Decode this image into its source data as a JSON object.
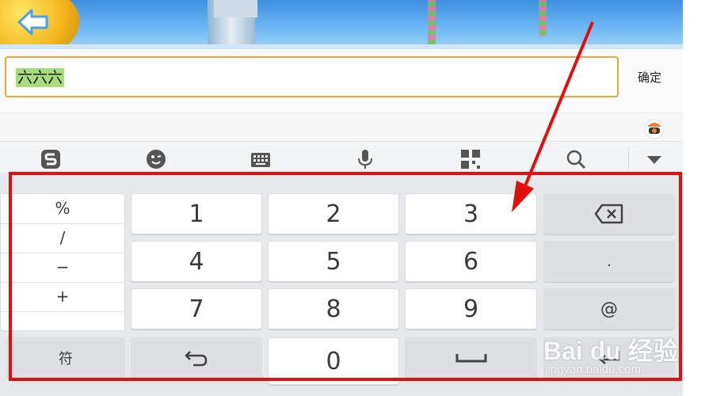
{
  "input": {
    "text": "六六六",
    "confirm_label": "确定"
  },
  "toolbar": {
    "icons": [
      "sogou-logo-icon",
      "emoji-icon",
      "keyboard-icon",
      "microphone-icon",
      "qr-grid-icon",
      "search-icon",
      "collapse-triangle-icon"
    ]
  },
  "keyboard": {
    "symbols": [
      "%",
      "/",
      "−",
      "+"
    ],
    "digits": [
      "1",
      "2",
      "3",
      "4",
      "5",
      "6",
      "7",
      "8",
      "9",
      "0"
    ],
    "dot_label": ".",
    "at_label": "@",
    "symbol_key_label": "符"
  },
  "watermark": {
    "brand": "Bai du 经验",
    "url": "jingyan.baidu.com"
  },
  "colors": {
    "input_border": "#f0a341",
    "selection": "#a6dc7c",
    "annotation": "#e11010"
  }
}
